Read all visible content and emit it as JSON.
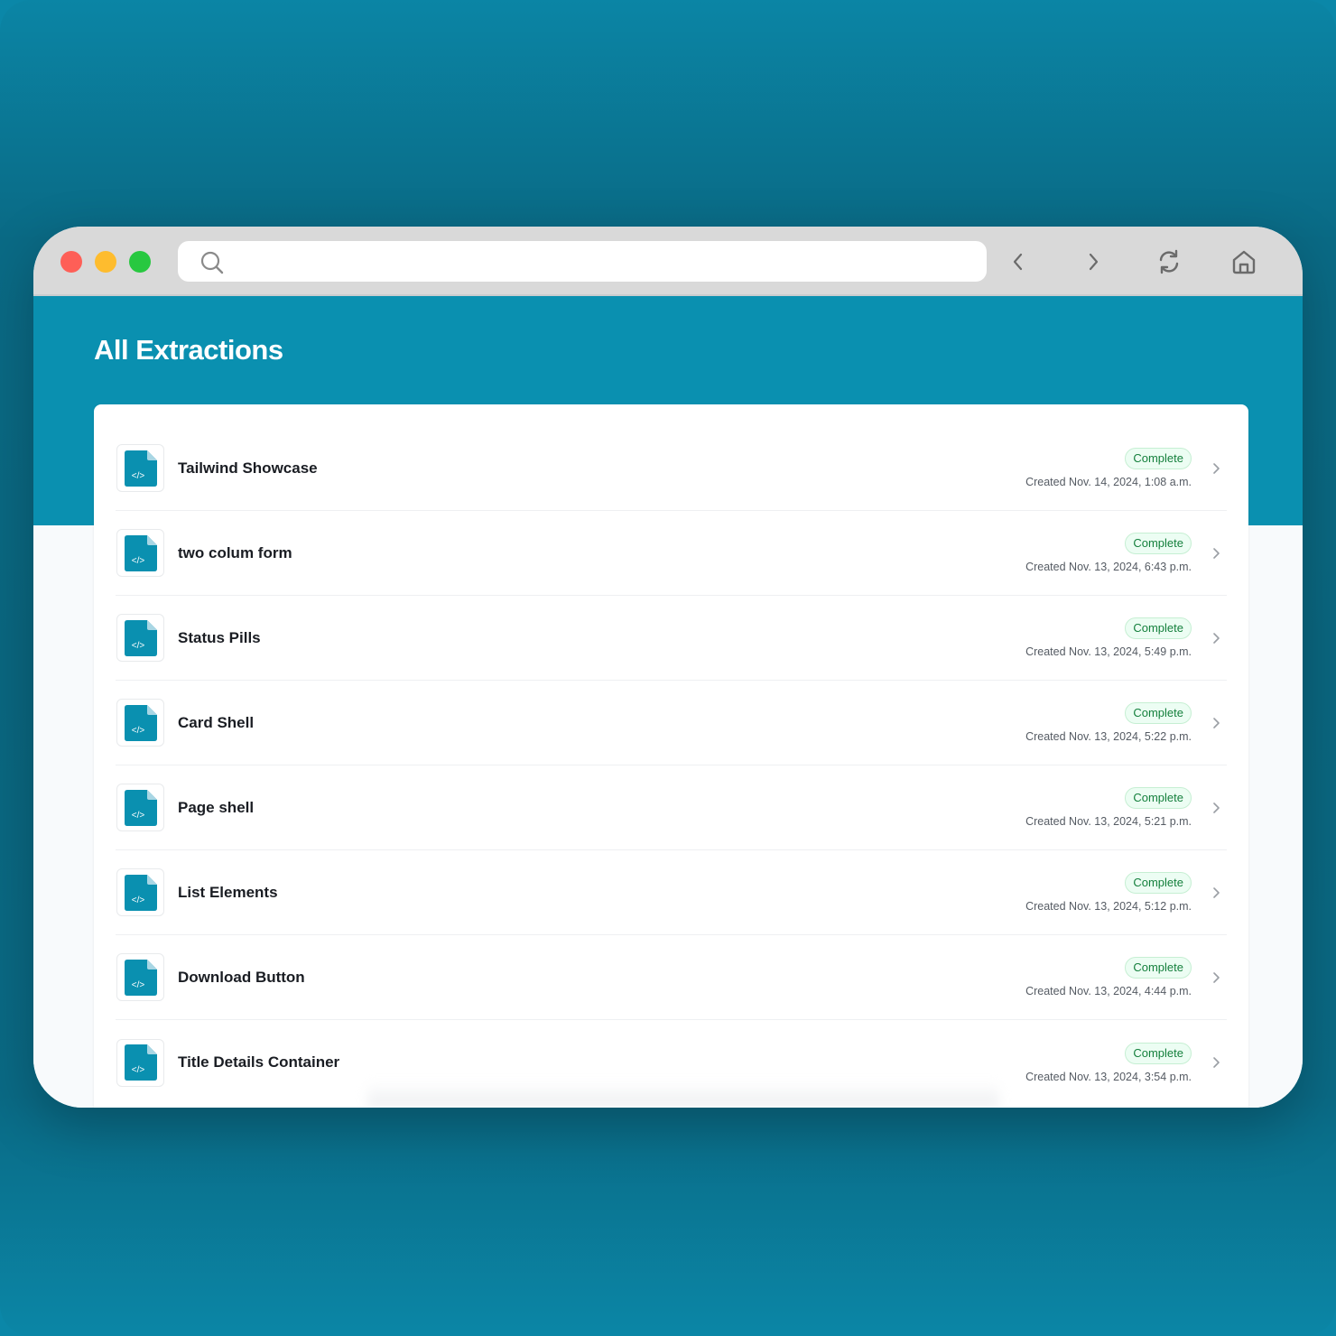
{
  "browser": {
    "traffic_lights": [
      "close",
      "minimize",
      "maximize"
    ],
    "url_value": "",
    "url_placeholder": "",
    "nav": {
      "back_icon": "chevron-left-icon",
      "forward_icon": "chevron-right-icon",
      "reload_icon": "reload-icon",
      "home_icon": "home-icon"
    }
  },
  "page": {
    "title": "All Extractions"
  },
  "colors": {
    "accent": "#0a90b0",
    "badge_text": "#15803d",
    "badge_bg": "#ecfdf3"
  },
  "extractions": [
    {
      "title": "Tailwind Showcase",
      "status": "Complete",
      "created": "Created Nov. 14, 2024, 1:08 a.m."
    },
    {
      "title": "two colum form",
      "status": "Complete",
      "created": "Created Nov. 13, 2024, 6:43 p.m."
    },
    {
      "title": "Status Pills",
      "status": "Complete",
      "created": "Created Nov. 13, 2024, 5:49 p.m."
    },
    {
      "title": "Card Shell",
      "status": "Complete",
      "created": "Created Nov. 13, 2024, 5:22 p.m."
    },
    {
      "title": "Page shell",
      "status": "Complete",
      "created": "Created Nov. 13, 2024, 5:21 p.m."
    },
    {
      "title": "List Elements",
      "status": "Complete",
      "created": "Created Nov. 13, 2024, 5:12 p.m."
    },
    {
      "title": "Download Button",
      "status": "Complete",
      "created": "Created Nov. 13, 2024, 4:44 p.m."
    },
    {
      "title": "Title Details Container",
      "status": "Complete",
      "created": "Created Nov. 13, 2024, 3:54 p.m."
    }
  ],
  "file_icon_glyph": "</>"
}
